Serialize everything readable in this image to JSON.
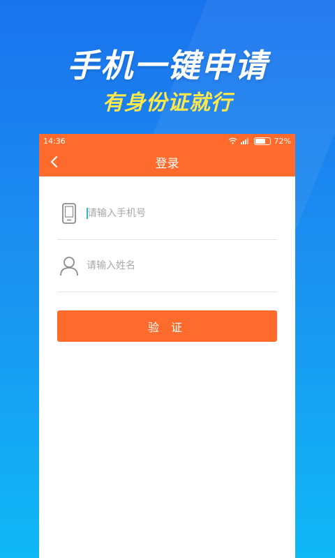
{
  "promo": {
    "headline": "手机一键申请",
    "subline": "有身份证就行"
  },
  "status_bar": {
    "time": "14:36",
    "battery": "72%",
    "battery_level": 0.72
  },
  "nav": {
    "title": "登录"
  },
  "form": {
    "phone_placeholder": "请输入手机号",
    "name_placeholder": "请输入姓名",
    "verify_label": "验 证"
  },
  "colors": {
    "accent": "#ff6b2c",
    "background_top": "#1a73ee",
    "background_bottom": "#10b8f6",
    "subline": "#ffe94a"
  }
}
